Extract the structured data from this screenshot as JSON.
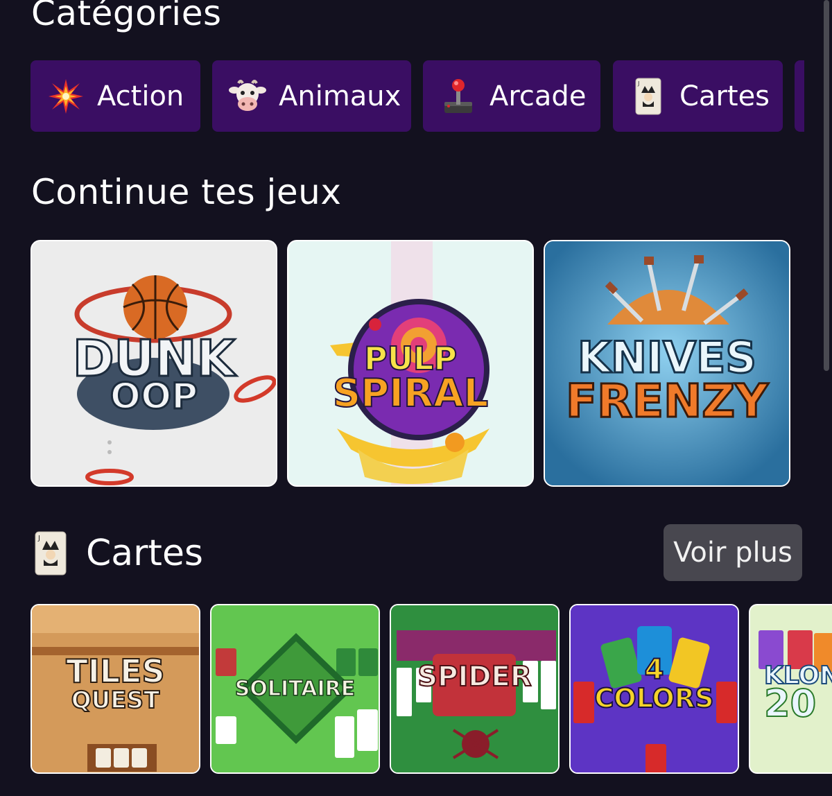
{
  "categories": {
    "title": "Catégories",
    "chips": [
      {
        "label": "Action",
        "icon": "collision-icon"
      },
      {
        "label": "Animaux",
        "icon": "cow-icon"
      },
      {
        "label": "Arcade",
        "icon": "joystick-icon"
      },
      {
        "label": "Cartes",
        "icon": "joker-card-icon"
      }
    ]
  },
  "continue": {
    "title": "Continue tes jeux",
    "games": [
      {
        "logo_line1": "DUNK",
        "logo_line2": "OOP"
      },
      {
        "logo_line1": "PULP",
        "logo_line2": "SPIRAL"
      },
      {
        "logo_line1": "KNIVES",
        "logo_line2": "FRENZY"
      }
    ]
  },
  "cartes": {
    "title": "Cartes",
    "voir_plus": "Voir plus",
    "games": [
      {
        "logo_line1": "TILES",
        "logo_line2": "QUEST"
      },
      {
        "logo_line1": "SOLITAIRE"
      },
      {
        "logo_line1": "SPIDER"
      },
      {
        "logo_line1": "4",
        "logo_line2": "COLORS"
      },
      {
        "logo_line1": "KLON",
        "logo_line2": "20"
      }
    ]
  },
  "colors": {
    "background": "#13111f",
    "chip": "#3a0e63",
    "button": "#48474f"
  }
}
